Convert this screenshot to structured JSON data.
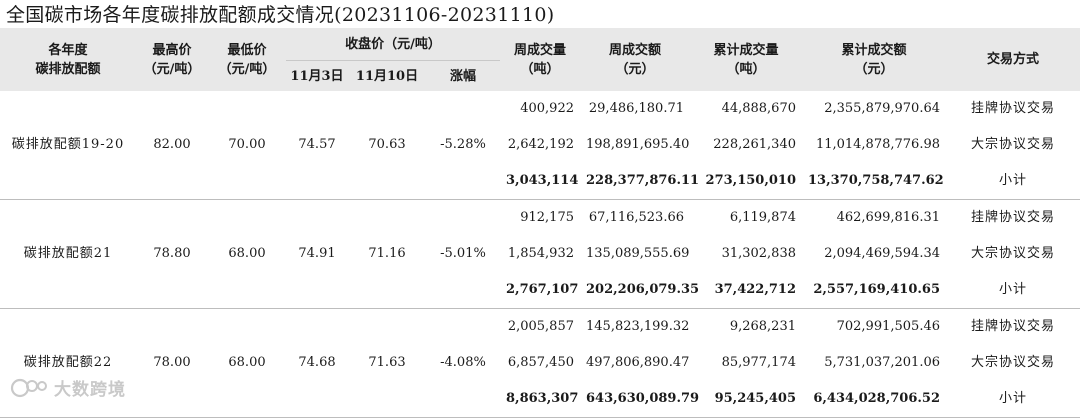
{
  "title": "全国碳市场各年度碳排放配额成交情况(20231106-20231110)",
  "header": {
    "category": [
      "各年度",
      "碳排放配额"
    ],
    "high": [
      "最高价",
      "（元/吨）"
    ],
    "low": [
      "最低价",
      "（元/吨）"
    ],
    "close_group": "收盘价（元/吨）",
    "close_nov3": "11月3日",
    "close_nov10": "11月10日",
    "change": "涨幅",
    "week_vol": [
      "周成交量",
      "（吨）"
    ],
    "week_amt": [
      "周成交额",
      "（元）"
    ],
    "cum_vol": [
      "累计成交量",
      "（吨）"
    ],
    "cum_amt": [
      "累计成交额",
      "（元）"
    ],
    "mode": "交易方式"
  },
  "groups": [
    {
      "name": "碳排放配额19-20",
      "high": "82.00",
      "low": "70.00",
      "close_nov3": "74.57",
      "close_nov10": "70.63",
      "change": "-5.28%",
      "rows": [
        {
          "week_vol": "400,922",
          "week_amt": "29,486,180.71",
          "cum_vol": "44,888,670",
          "cum_amt": "2,355,879,970.64",
          "mode": "挂牌协议交易"
        },
        {
          "week_vol": "2,642,192",
          "week_amt": "198,891,695.40",
          "cum_vol": "228,261,340",
          "cum_amt": "11,014,878,776.98",
          "mode": "大宗协议交易"
        },
        {
          "week_vol": "3,043,114",
          "week_amt": "228,377,876.11",
          "cum_vol": "273,150,010",
          "cum_amt": "13,370,758,747.62",
          "mode": "小计"
        }
      ]
    },
    {
      "name": "碳排放配额21",
      "high": "78.80",
      "low": "68.00",
      "close_nov3": "74.91",
      "close_nov10": "71.16",
      "change": "-5.01%",
      "rows": [
        {
          "week_vol": "912,175",
          "week_amt": "67,116,523.66",
          "cum_vol": "6,119,874",
          "cum_amt": "462,699,816.31",
          "mode": "挂牌协议交易"
        },
        {
          "week_vol": "1,854,932",
          "week_amt": "135,089,555.69",
          "cum_vol": "31,302,838",
          "cum_amt": "2,094,469,594.34",
          "mode": "大宗协议交易"
        },
        {
          "week_vol": "2,767,107",
          "week_amt": "202,206,079.35",
          "cum_vol": "37,422,712",
          "cum_amt": "2,557,169,410.65",
          "mode": "小计"
        }
      ]
    },
    {
      "name": "碳排放配额22",
      "high": "78.00",
      "low": "68.00",
      "close_nov3": "74.68",
      "close_nov10": "71.63",
      "change": "-4.08%",
      "rows": [
        {
          "week_vol": "2,005,857",
          "week_amt": "145,823,199.32",
          "cum_vol": "9,268,231",
          "cum_amt": "702,991,505.46",
          "mode": "挂牌协议交易"
        },
        {
          "week_vol": "6,857,450",
          "week_amt": "497,806,890.47",
          "cum_vol": "85,977,174",
          "cum_amt": "5,731,037,201.06",
          "mode": "大宗协议交易"
        },
        {
          "week_vol": "8,863,307",
          "week_amt": "643,630,089.79",
          "cum_vol": "95,245,405",
          "cum_amt": "6,434,028,706.52",
          "mode": "小计"
        }
      ]
    }
  ],
  "watermark": "大数跨境",
  "colors": {
    "header_bg": "#e8e8e8",
    "watermark": "#c9c9c9"
  }
}
